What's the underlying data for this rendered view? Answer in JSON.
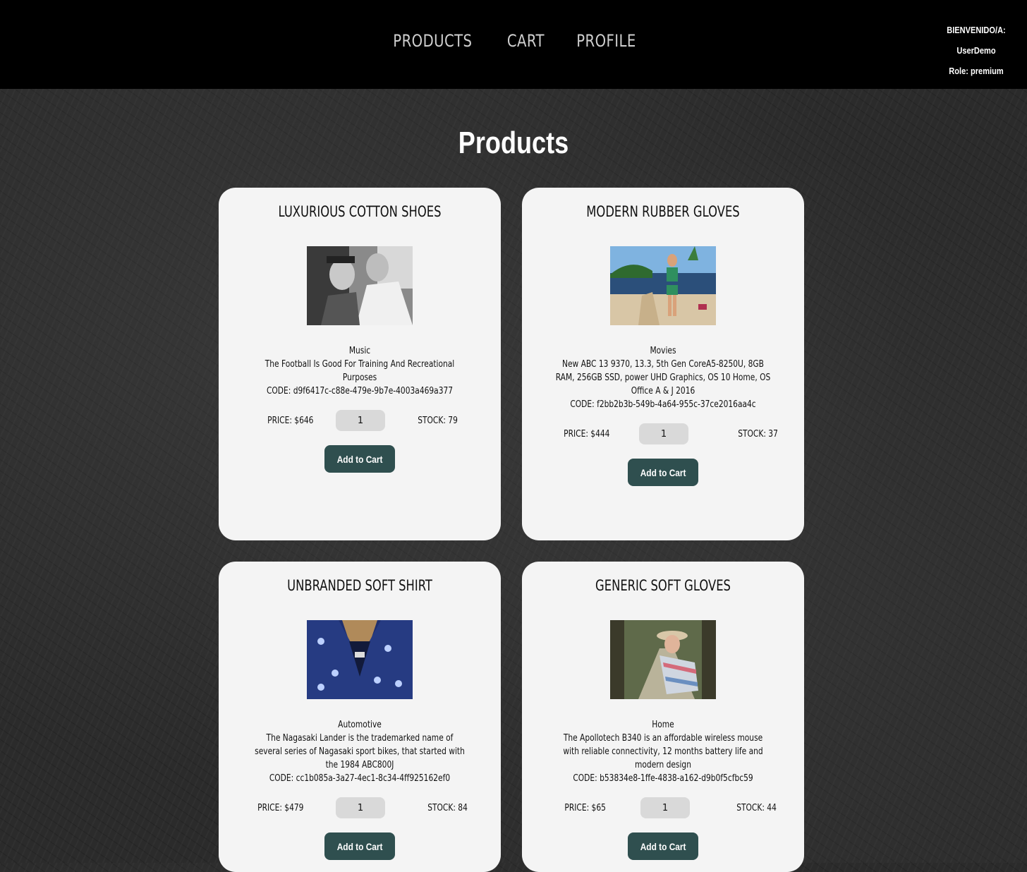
{
  "nav": {
    "links": [
      "PRODUCTS",
      "CART",
      "PROFILE"
    ]
  },
  "user": {
    "greeting": "BIENVENIDO/A:",
    "name": "UserDemo",
    "role": "Role: premium"
  },
  "page": {
    "title": "Products"
  },
  "products": [
    {
      "name": "LUXURIOUS COTTON SHOES",
      "category": "Music",
      "description": "The Football Is Good For Training And Recreational Purposes",
      "code": "CODE: d9f6417c-c88e-479e-9b7e-4003a469a377",
      "price": "PRICE: $646",
      "quantity": "1",
      "stock": "STOCK: 79",
      "button": "Add to Cart",
      "image_icon": "photo-bw-woman-icon"
    },
    {
      "name": "MODERN RUBBER GLOVES",
      "category": "Movies",
      "description": "New ABC 13 9370, 13.3, 5th Gen CoreA5-8250U, 8GB RAM, 256GB SSD, power UHD Graphics, OS 10 Home, OS Office A & J 2016",
      "code": "CODE: f2bb2b3b-549b-4a64-955c-37ce2016aa4c",
      "price": "PRICE: $444",
      "quantity": "1",
      "stock": "STOCK: 37",
      "button": "Add to Cart",
      "image_icon": "photo-beach-avatar-icon"
    },
    {
      "name": "UNBRANDED SOFT SHIRT",
      "category": "Automotive",
      "description": "The Nagasaki Lander is the trademarked name of several series of Nagasaki sport bikes, that started with the 1984 ABC800J",
      "code": "CODE: cc1b085a-3a27-4ec1-8c34-4ff925162ef0",
      "price": "PRICE: $479",
      "quantity": "1",
      "stock": "STOCK: 84",
      "button": "Add to Cart",
      "image_icon": "photo-blue-shirt-icon"
    },
    {
      "name": "GENERIC SOFT GLOVES",
      "category": "Home",
      "description": "The Apollotech B340 is an affordable wireless mouse with reliable connectivity, 12 months battery life and modern design",
      "code": "CODE: b53834e8-1ffe-4838-a162-d9b0f5cfbc59",
      "price": "PRICE: $65",
      "quantity": "1",
      "stock": "STOCK: 44",
      "button": "Add to Cart",
      "image_icon": "photo-woman-hat-icon"
    }
  ],
  "colors": {
    "navbar": "#000000",
    "card": "#f4f4f4",
    "button": "#2f4f4f",
    "quantity_field": "#d9d9d9"
  }
}
